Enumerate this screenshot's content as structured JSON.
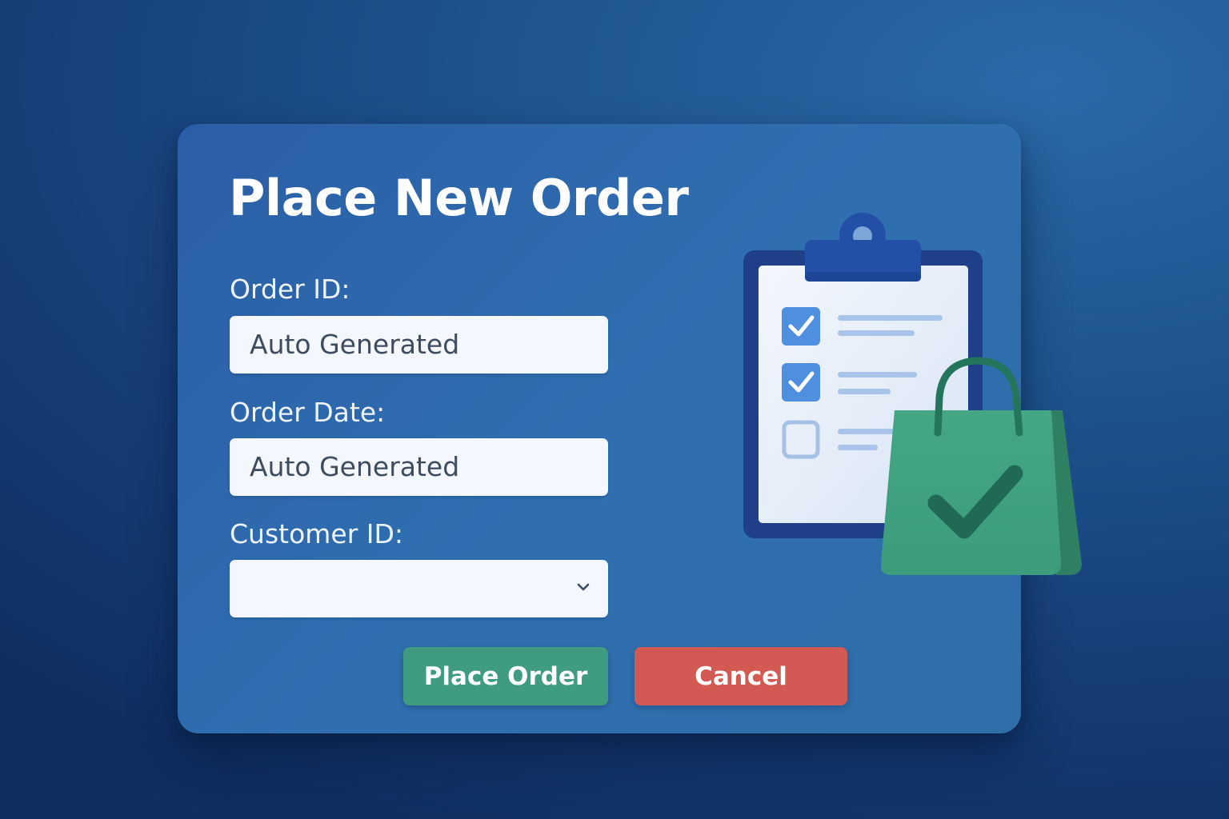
{
  "dialog": {
    "title": "Place New Order",
    "fields": [
      {
        "label": "Order ID:",
        "value": "Auto Generated",
        "type": "text"
      },
      {
        "label": "Order Date:",
        "value": "Auto Generated",
        "type": "text"
      },
      {
        "label": "Customer ID:",
        "value": "",
        "type": "select"
      }
    ],
    "buttons": {
      "place_label": "Place Order",
      "cancel_label": "Cancel"
    }
  },
  "illustration": {
    "icons": [
      "clipboard-checklist-icon",
      "shopping-bag-check-icon"
    ]
  },
  "colors": {
    "background": "#163f78",
    "card": "#2b5ea6",
    "place_button": "#3f9c80",
    "cancel_button": "#d25a52",
    "field_background": "#f4f7fd",
    "clipboard_frame": "#1f3f88",
    "bag": "#45a887"
  }
}
